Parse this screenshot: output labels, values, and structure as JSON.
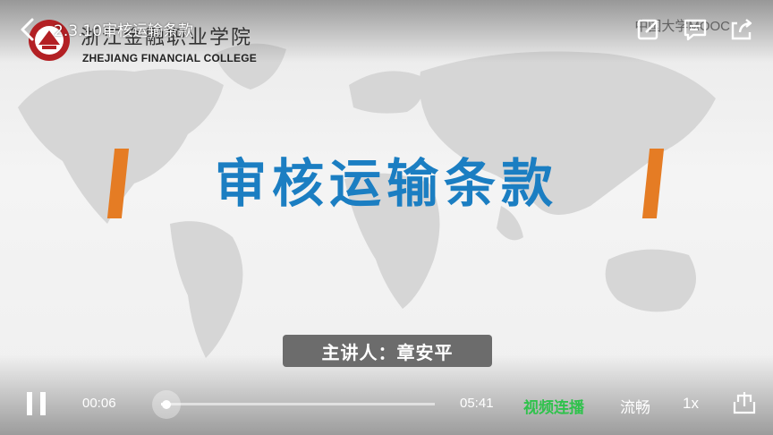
{
  "header": {
    "title": "2.3.10审核运输条款",
    "watermark": "中国大学MOOC"
  },
  "college": {
    "name_cn": "浙江金融职业学院",
    "name_en": "ZHEJIANG FINANCIAL COLLEGE"
  },
  "slide": {
    "title": "审核运输条款",
    "speaker": "主讲人：章安平"
  },
  "controls": {
    "current_time": "00:06",
    "total_time": "05:41",
    "progress": 0.018,
    "autoplay_label": "视频连播",
    "quality_label": "流畅",
    "speed_label": "1x"
  },
  "colors": {
    "title_blue": "#1b7ec2",
    "accent_orange": "#e57c24",
    "autoplay_green": "#2fc24c"
  },
  "icons": [
    "back-arrow-icon",
    "note-icon",
    "comment-icon",
    "share-icon",
    "pause-icon",
    "cast-icon"
  ]
}
